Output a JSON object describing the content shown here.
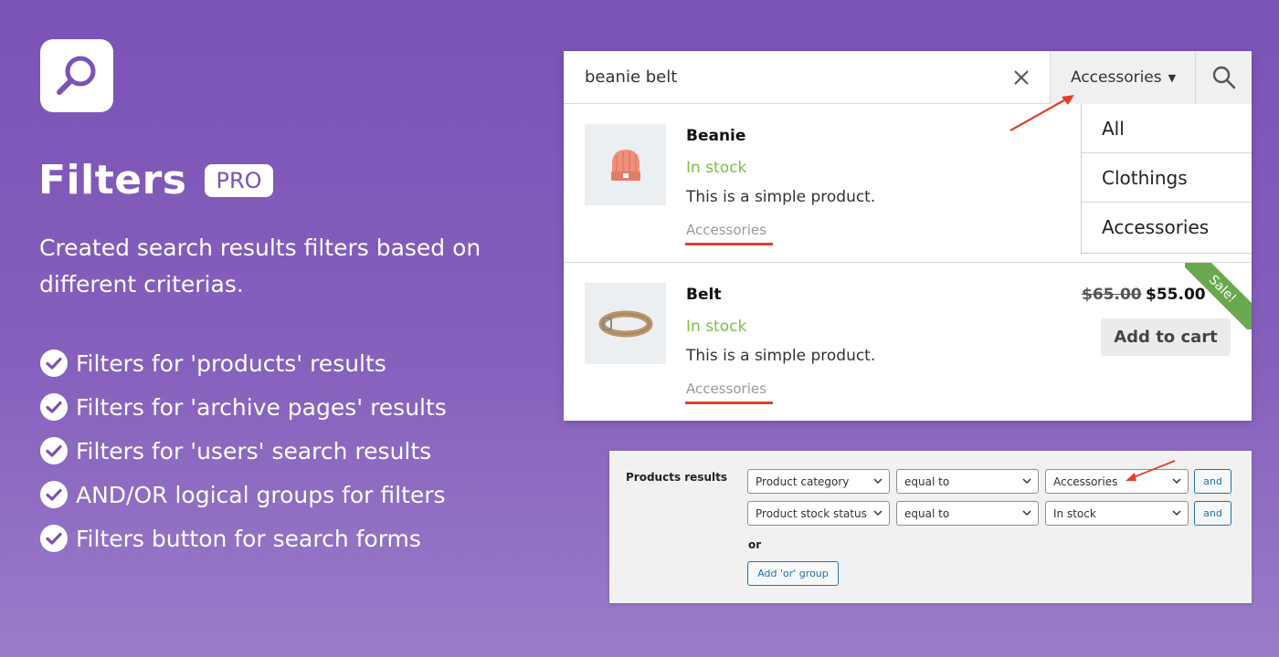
{
  "header": {
    "title": "Filters",
    "badge": "PRO",
    "subtitle": "Created search results filters based on different criterias."
  },
  "features": [
    "Filters for 'products' results",
    "Filters for 'archive pages' results",
    "Filters for 'users' search results",
    "AND/OR logical groups for filters",
    "Filters button for search forms"
  ],
  "search": {
    "query": "beanie belt",
    "category_select": "Accessories",
    "dropdown_options": [
      "All",
      "Clothings",
      "Accessories"
    ]
  },
  "results": [
    {
      "name": "Beanie",
      "stock": "In stock",
      "description": "This is a simple product.",
      "category": "Accessories"
    },
    {
      "name": "Belt",
      "stock": "In stock",
      "description": "This is a simple product.",
      "category": "Accessories",
      "old_price": "$65.00",
      "price": "$55.00",
      "add_to_cart": "Add to cart",
      "badge": "Sale!"
    }
  ],
  "admin": {
    "label": "Products results",
    "rows": [
      {
        "field": "Product category",
        "operator": "equal to",
        "value": "Accessories",
        "logic": "and"
      },
      {
        "field": "Product stock status",
        "operator": "equal to",
        "value": "In stock",
        "logic": "and"
      }
    ],
    "or_label": "or",
    "add_or_group": "Add 'or' group"
  },
  "colors": {
    "background": "#7b52b6",
    "accent_purple": "#7b52b6",
    "in_stock_green": "#7ac142",
    "underline_red": "#e0402a",
    "sale_green": "#6aa84f",
    "wp_blue": "#2271b1"
  },
  "icons": {
    "logo": "search-magnifier-icon",
    "feature_bullet": "check-circle-icon",
    "clear": "close-icon",
    "search": "search-icon",
    "caret": "caret-down-icon",
    "select": "chevron-down-icon"
  }
}
